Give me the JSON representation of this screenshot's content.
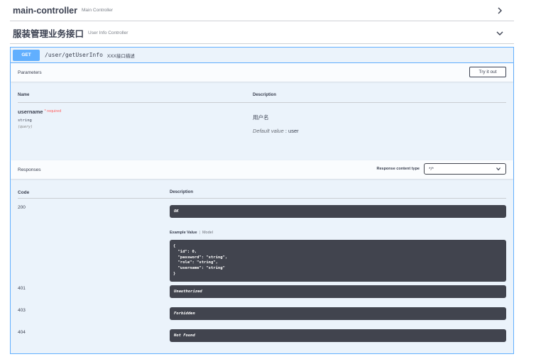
{
  "tags": [
    {
      "name": "main-controller",
      "description": "Main Controller",
      "expanded": false
    },
    {
      "name": "服装管理业务接口",
      "description": "User Info Controller",
      "expanded": true
    }
  ],
  "operation": {
    "method": "GET",
    "path": "/user/getUserInfo",
    "summary": "XXX接口描述",
    "parameters_title": "Parameters",
    "try_button": "Try it out",
    "param_headers": {
      "name": "Name",
      "description": "Description"
    },
    "parameter": {
      "name": "username",
      "required": "* required",
      "type": "string",
      "in": "(query)",
      "description": "用户名",
      "default_label": "Default value",
      "default_value": " : user"
    },
    "responses_title": "Responses",
    "response_content_type_label": "Response content type",
    "response_content_type": "*/*",
    "resp_headers": {
      "code": "Code",
      "description": "Description"
    },
    "example_tabs": {
      "active": "Example Value",
      "inactive": "Model"
    },
    "example_value": "{\n  \"id\": 0,\n  \"password\": \"string\",\n  \"role\": \"string\",\n  \"username\": \"string\"\n}",
    "responses": [
      {
        "code": "200",
        "description": "OK"
      },
      {
        "code": "401",
        "description": "Unauthorized"
      },
      {
        "code": "403",
        "description": "Forbidden"
      },
      {
        "code": "404",
        "description": "Not Found"
      }
    ]
  },
  "colors": {
    "get": "#61affe",
    "dark": "#41444e",
    "required": "#ff6060"
  }
}
